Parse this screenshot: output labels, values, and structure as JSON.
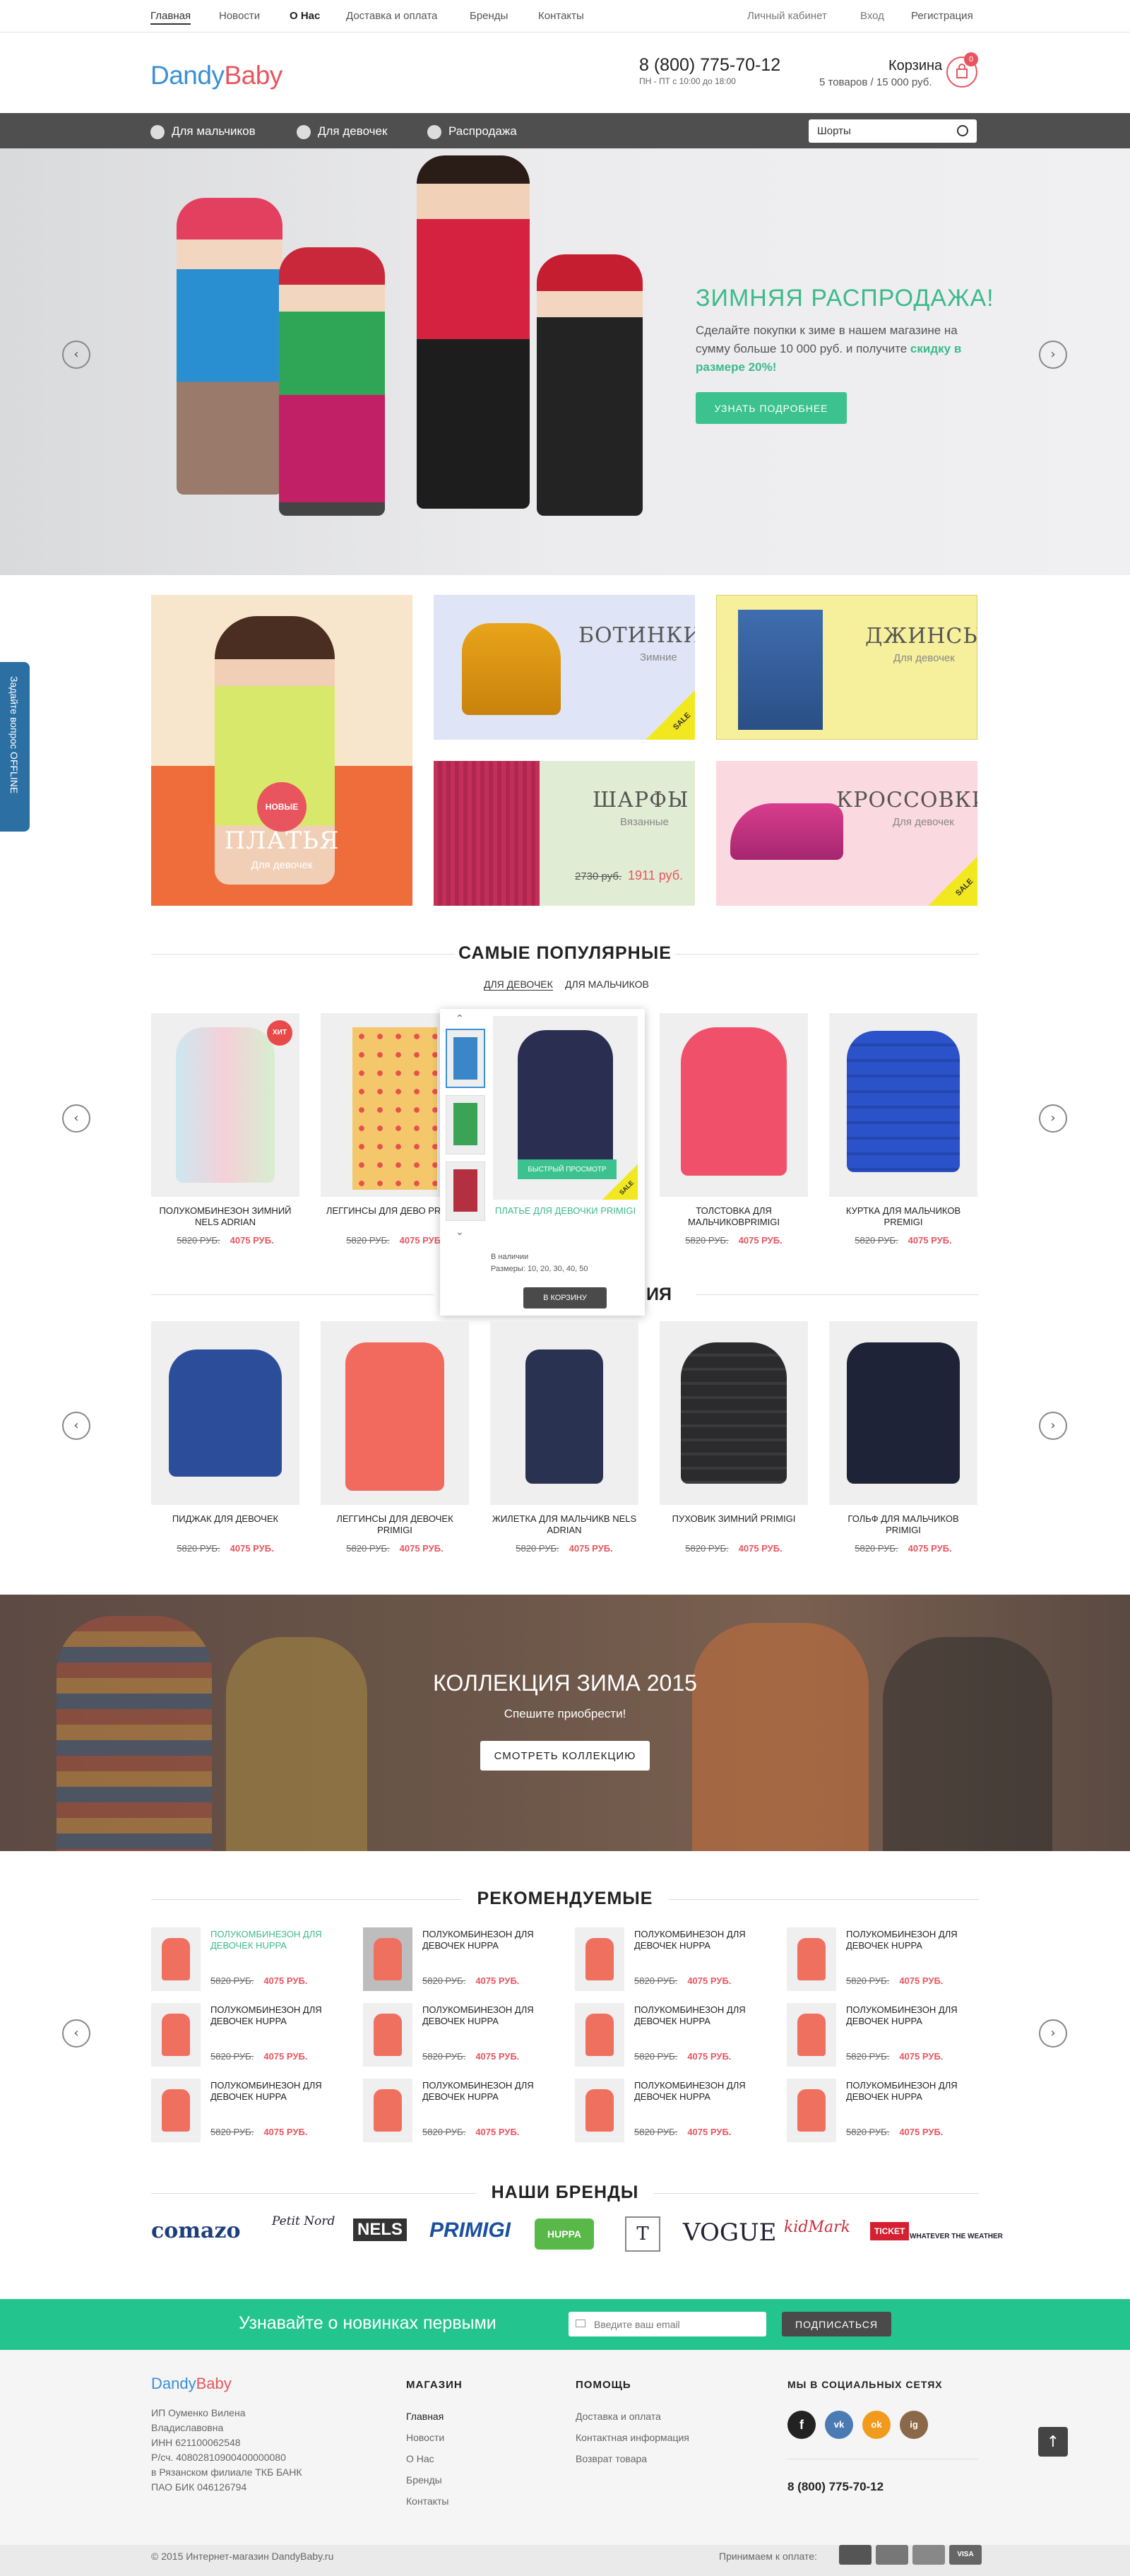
{
  "topnav": {
    "items": [
      "Главная",
      "Новости",
      "О Нас",
      "Доставка и оплата",
      "Бренды",
      "Контакты"
    ],
    "account": "Личный кабинет",
    "login": "Вход",
    "register": "Регистрация"
  },
  "header": {
    "logo_a": "Dandy",
    "logo_b": "Baby",
    "phone": "8 (800) 775-70-12",
    "hours": "ПН - ПТ с 10:00 до 18:00",
    "cart_title": "Корзина",
    "cart_summary": "5 товаров / 15 000 руб.",
    "cart_count": "0"
  },
  "nav": {
    "boys": "Для мальчиков",
    "girls": "Для девочек",
    "sale": "Распродажа",
    "search_value": "Шорты"
  },
  "hero": {
    "title": "ЗИМНЯЯ РАСПРОДАЖА!",
    "text": "Сделайте покупки к зиме в нашем магазине на сумму больше 10 000 руб. и получите ",
    "text_bold": "скидку в размере 20%!",
    "button": "УЗНАТЬ ПОДРОБНЕЕ"
  },
  "side_tab": "Задайте вопрос OFFLINE",
  "tiles": {
    "dresses": {
      "badge": "НОВЫЕ",
      "title": "ПЛАТЬЯ",
      "sub": "Для девочек"
    },
    "boots": {
      "title": "БОТИНКИ",
      "sub": "Зимние",
      "sale": "SALE"
    },
    "jeans": {
      "title": "ДЖИНСЫ",
      "sub": "Для девочек"
    },
    "scarves": {
      "title": "ШАРФЫ",
      "sub": "Вязанные",
      "old": "2730 руб.",
      "new": "1911 руб."
    },
    "sneakers": {
      "title": "КРОССОВКИ",
      "sub": "Для девочек",
      "sale": "SALE"
    }
  },
  "popular": {
    "title": "САМЫЕ ПОПУЛЯРНЫЕ",
    "tab_girls": "ДЛЯ ДЕВОЧЕК",
    "tab_boys": "ДЛЯ МАЛЬЧИКОВ",
    "items": [
      {
        "name": "ПОЛУКОМБИНЕЗОН ЗИМНИЙ NELS ADRIAN",
        "old": "5820 РУБ.",
        "new": "4075 РУБ.",
        "badge": "ХИТ"
      },
      {
        "name": "ЛЕГГИНСЫ ДЛЯ ДЕВО PRIMIGI",
        "old": "5820 РУБ.",
        "new": "4075 РУБ."
      },
      {
        "name": "ПЛАТЬЕ ДЛЯ ДЕВОЧКИ PRIMIGI",
        "old": "5820 РУБ.",
        "new": "4075 РУБ."
      },
      {
        "name": "ТОЛСТОВКА ДЛЯ МАЛЬЧИКОВPRIMIGI",
        "old": "5820 РУБ.",
        "new": "4075 РУБ."
      },
      {
        "name": "КУРТКА ДЛЯ МАЛЬЧИКОВ PREMIGI",
        "old": "5820 РУБ.",
        "new": "4075 РУБ."
      }
    ]
  },
  "quickview": {
    "button": "БЫСТРЫЙ ПРОСМОТР",
    "sale": "SALE",
    "name": "ПЛАТЬЕ ДЛЯ ДЕВОЧКИ PRIMIGI",
    "stock": "В наличии",
    "sizes": "Размеры: 10, 20, 30, 40, 50",
    "cart": "В КОРЗИНУ"
  },
  "second": {
    "title_tail": "ИЯ",
    "items": [
      {
        "name": "ПИДЖАК ДЛЯ ДЕВОЧЕК",
        "old": "5820 РУБ.",
        "new": "4075 РУБ."
      },
      {
        "name": "ЛЕГГИНСЫ ДЛЯ ДЕВОЧЕК PRIMIGI",
        "old": "5820 РУБ.",
        "new": "4075 РУБ."
      },
      {
        "name": "ЖИЛЕТКА ДЛЯ МАЛЬЧИКВ NELS ADRIAN",
        "old": "5820 РУБ.",
        "new": "4075 РУБ."
      },
      {
        "name": "ПУХОВИК ЗИМНИЙ PRIMIGI",
        "old": "5820 РУБ.",
        "new": "4075 РУБ."
      },
      {
        "name": "ГОЛЬФ ДЛЯ МАЛЬЧИКОВ PRIMIGI",
        "old": "5820 РУБ.",
        "new": "4075 РУБ."
      }
    ]
  },
  "collection": {
    "title": "КОЛЛЕКЦИЯ ЗИМА 2015",
    "sub": "Спешите приобрести!",
    "button": "СМОТРЕТЬ КОЛЛЕКЦИЮ"
  },
  "recommended": {
    "title": "РЕКОМЕНДУЕМЫЕ",
    "name": "ПОЛУКОМБИНЕЗОН ДЛЯ ДЕВОЧЕК HUPPA",
    "old": "5820 РУБ.",
    "new": "4075 РУБ."
  },
  "brands": {
    "title": "НАШИ БРЕНДЫ",
    "items": [
      "comazo",
      "Petit Nord",
      "NELS",
      "PRIMIGI",
      "HUPPA",
      "T",
      "VOGUE",
      "kidMark",
      "TICKET",
      "WHATEVER THE WEATHER"
    ]
  },
  "subscribe": {
    "title": "Узнавайте о новинках первыми",
    "placeholder": "Введите ваш email",
    "button": "ПОДПИСАТЬСЯ"
  },
  "footer": {
    "company": [
      "ИП Оуменко Вилена",
      "Владиславовна",
      "ИНН 621100062548",
      "Р/сч. 40802810900400000080",
      "в Рязанском филиале ТКБ БАНК",
      "ПАО БИК 046126794"
    ],
    "shop_title": "МАГАЗИН",
    "shop": [
      "Главная",
      "Новости",
      "О Нас",
      "Бренды",
      "Контакты"
    ],
    "help_title": "ПОМОЩЬ",
    "help": [
      "Доставка и оплата",
      "Контактная информация",
      "Возврат товара"
    ],
    "social_title": "МЫ В СОЦИАЛЬНЫХ СЕТЯХ",
    "social": [
      "f",
      "vk",
      "ok",
      "ig"
    ],
    "phone": "8 (800) 775-70-12",
    "copyright": "© 2015 Интернет-магазин DandyBaby.ru",
    "payment_label": "Принимаем к оплате:",
    "payments": [
      "",
      "",
      "",
      "VISA"
    ]
  }
}
